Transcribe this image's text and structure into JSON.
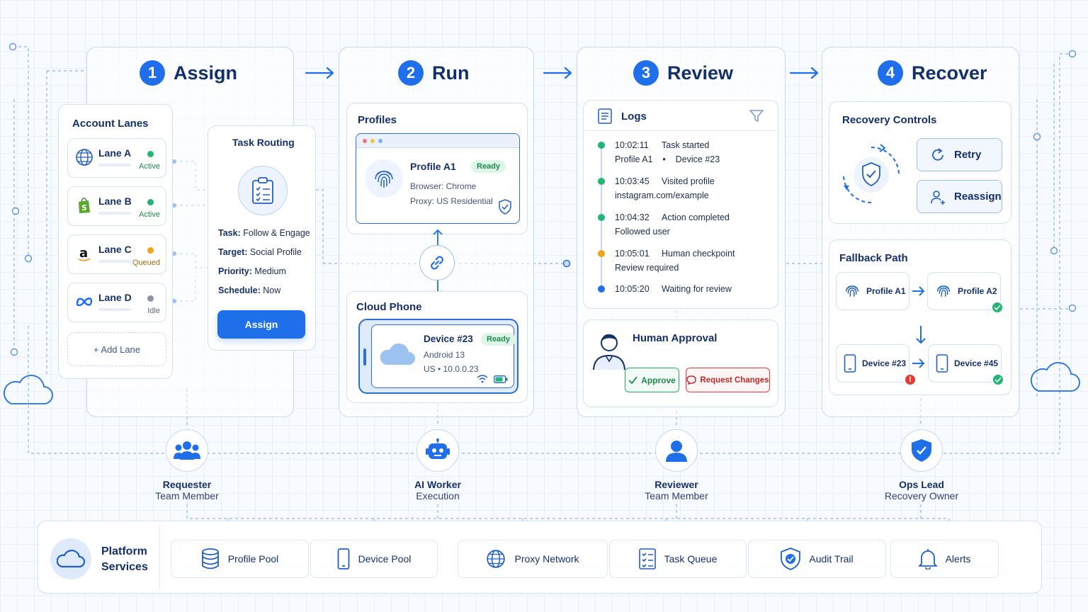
{
  "stages": [
    {
      "num": "1",
      "title": "Assign"
    },
    {
      "num": "2",
      "title": "Run"
    },
    {
      "num": "3",
      "title": "Review"
    },
    {
      "num": "4",
      "title": "Recover"
    }
  ],
  "assign": {
    "lanes_title": "Account Lanes",
    "lanes": [
      {
        "name": "Lane A",
        "status": "Active",
        "color": "#22b573",
        "icon": "globe-icon"
      },
      {
        "name": "Lane B",
        "status": "Active",
        "color": "#22b573",
        "icon": "shopify-icon"
      },
      {
        "name": "Lane C",
        "status": "Queued",
        "color": "#f2a21b",
        "icon": "amazon-icon"
      },
      {
        "name": "Lane D",
        "status": "Idle",
        "color": "#8a94a6",
        "icon": "meta-icon"
      }
    ],
    "add_lane": "+ Add Lane",
    "routing_title": "Task Routing",
    "routing": [
      {
        "label": "Task:",
        "value": "Follow & Engage"
      },
      {
        "label": "Target:",
        "value": "Social Profile"
      },
      {
        "label": "Priority:",
        "value": "Medium"
      },
      {
        "label": "Schedule:",
        "value": "Now"
      }
    ],
    "assign_button": "Assign"
  },
  "run": {
    "profiles_title": "Profiles",
    "profile_name": "Profile A1",
    "profile_badge": "Ready",
    "profile_browser": "Browser: Chrome",
    "profile_proxy": "Proxy: US Residential",
    "cloud_title": "Cloud Phone",
    "device_name": "Device #23",
    "device_badge": "Ready",
    "device_os": "Android 13",
    "device_ip": "US  •  10.0.0.23"
  },
  "review": {
    "logs_title": "Logs",
    "logs": [
      {
        "time": "10:02:11",
        "text": "Task started",
        "sub": "Profile A1    •    Device #23",
        "color": "#22b573"
      },
      {
        "time": "10:03:45",
        "text": "Visited profile",
        "sub": "instagram.com/example",
        "color": "#22b573"
      },
      {
        "time": "10:04:32",
        "text": "Action completed",
        "sub": "Followed user",
        "color": "#22b573"
      },
      {
        "time": "10:05:01",
        "text": "Human checkpoint",
        "sub": "Review required",
        "color": "#f2a21b"
      },
      {
        "time": "10:05:20",
        "text": "Waiting for review",
        "sub": "",
        "color": "#1f6fea"
      }
    ],
    "approval_title": "Human Approval",
    "approve": "Approve",
    "request_changes": "Request Changes"
  },
  "recover": {
    "controls_title": "Recovery Controls",
    "retry": "Retry",
    "reassign": "Reassign",
    "fallback_title": "Fallback Path",
    "fallback": [
      {
        "label": "Profile A1",
        "icon": "fingerprint-icon"
      },
      {
        "label": "Profile A2",
        "icon": "fingerprint-icon"
      },
      {
        "label": "Device #23",
        "icon": "phone-icon"
      },
      {
        "label": "Device #45",
        "icon": "phone-icon"
      }
    ]
  },
  "personas": [
    {
      "title": "Requester",
      "sub": "Team Member",
      "icon": "team-icon"
    },
    {
      "title": "AI Worker",
      "sub": "Execution",
      "icon": "robot-icon"
    },
    {
      "title": "Reviewer",
      "sub": "Team Member",
      "icon": "user-icon"
    },
    {
      "title": "Ops Lead",
      "sub": "Recovery Owner",
      "icon": "shield-icon"
    }
  ],
  "platform": {
    "title_line1": "Platform",
    "title_line2": "Services",
    "services": [
      {
        "label": "Profile Pool",
        "icon": "database-icon"
      },
      {
        "label": "Device Pool",
        "icon": "phone-icon"
      },
      {
        "label": "Proxy Network",
        "icon": "globe-icon"
      },
      {
        "label": "Task Queue",
        "icon": "checklist-icon"
      },
      {
        "label": "Audit Trail",
        "icon": "shield-icon"
      },
      {
        "label": "Alerts",
        "icon": "bell-icon"
      }
    ]
  },
  "colors": {
    "accent": "#1f6fea",
    "success": "#22b573",
    "warning": "#f2a21b",
    "danger": "#e53935"
  }
}
